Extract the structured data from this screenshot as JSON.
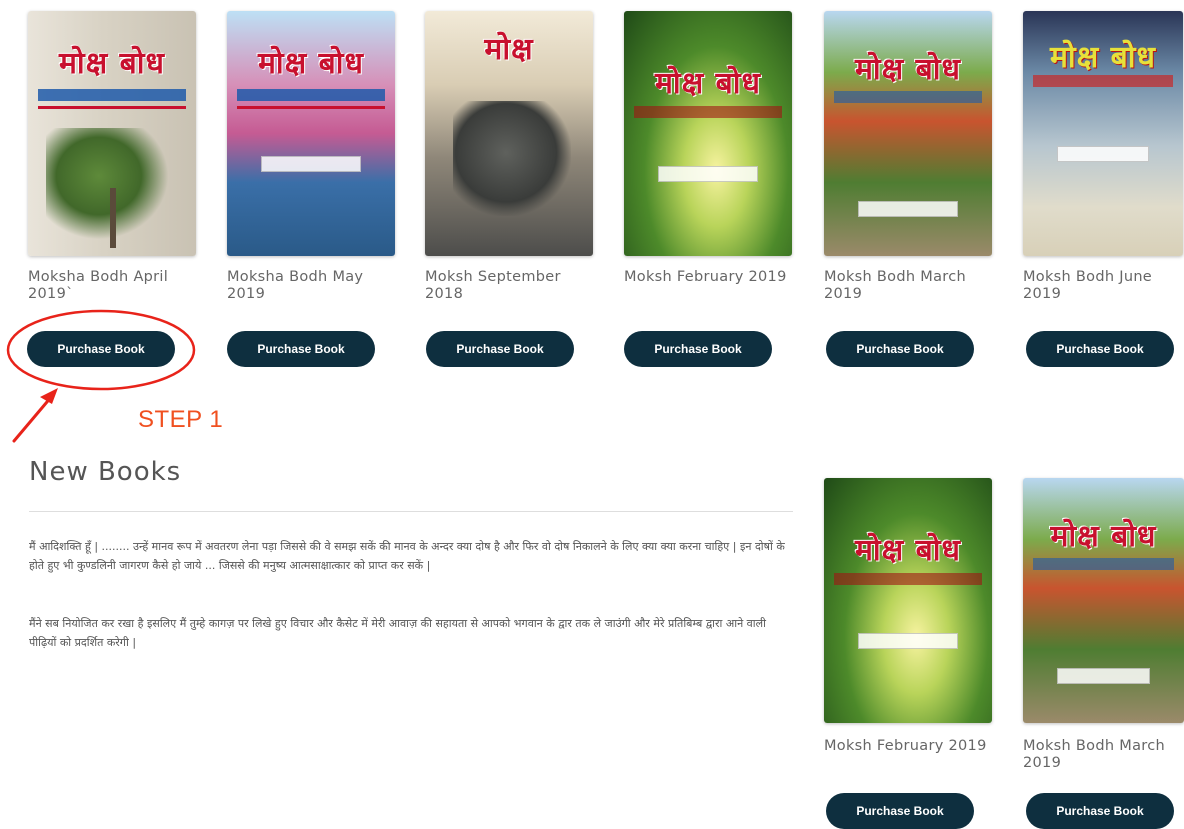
{
  "top_books": [
    {
      "title": "Moksha Bodh April 2019`",
      "button": "Purchase Book",
      "masthead": "मोक्ष बोध"
    },
    {
      "title": "Moksha Bodh May 2019",
      "button": "Purchase Book",
      "masthead": "मोक्ष बोध"
    },
    {
      "title": "Moksh September 2018",
      "button": "Purchase Book",
      "masthead": "मोक्ष"
    },
    {
      "title": "Moksh February 2019",
      "button": "Purchase Book",
      "masthead": "मोक्ष बोध"
    },
    {
      "title": "Moksh Bodh March 2019",
      "button": "Purchase Book",
      "masthead": "मोक्ष बोध"
    },
    {
      "title": "Moksh Bodh June 2019",
      "button": "Purchase Book",
      "masthead": "मोक्ष बोध"
    }
  ],
  "annotation": {
    "step_label": "STEP 1",
    "color": "#f05020"
  },
  "new_books": {
    "heading": "New Books",
    "paragraphs": [
      "मैं आदिशक्ति हूँ | ........ उन्हें मानव रूप में अवतरण लेना पड़ा जिससे की वे समझ सकें की मानव के अन्दर क्या दोष है और फिर वो दोष निकालने के लिए क्या क्या करना चाहिए | इन दोषों के होते हुए भी कुण्डलिनी जागरण कैसे हो जाये ... जिससे की मनुष्य आत्मसाक्षात्कार को प्राप्त कर सकें |",
      "मैंने सब नियोजित कर रखा है इसलिए मैं तुम्हे कागज़ पर लिखे हुए विचार और कैसेट में मेरी आवाज़ की सहायता से आपको भगवान के द्वार तक ले जाउंगी और मेरे प्रतिबिम्ब द्वारा आने वाली पीढ़ियों को प्रदर्शित करेगी |"
    ],
    "books": [
      {
        "title": "Moksh February 2019",
        "button": "Purchase Book",
        "masthead": "मोक्ष बोध"
      },
      {
        "title": "Moksh Bodh March 2019",
        "button": "Purchase Book",
        "masthead": "मोक्ष बोध"
      }
    ]
  },
  "colors": {
    "button_bg": "#0e2f3f",
    "button_text": "#ffffff",
    "annotation_red": "#e8231a"
  }
}
